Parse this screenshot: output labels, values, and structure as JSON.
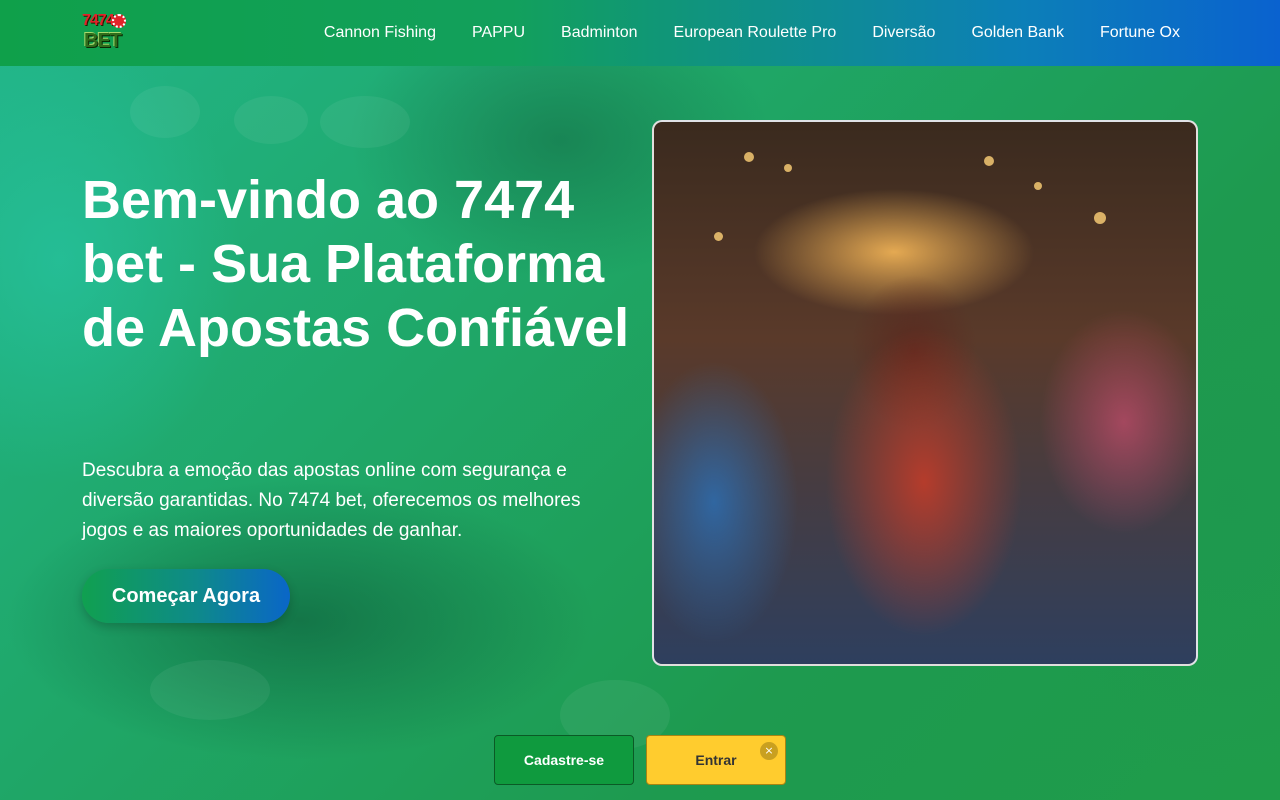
{
  "header": {
    "logo_text_top": "7474",
    "logo_text_bottom": "BET",
    "nav": [
      {
        "label": "Cannon Fishing"
      },
      {
        "label": "PAPPU"
      },
      {
        "label": "Badminton"
      },
      {
        "label": "European Roulette Pro"
      },
      {
        "label": "Diversão"
      },
      {
        "label": "Golden Bank"
      },
      {
        "label": "Fortune Ox"
      }
    ]
  },
  "hero": {
    "title": "Bem-vindo ao 7474 bet - Sua Plataforma de Apostas Confiável",
    "description": "Descubra a emoção das apostas online com segurança e diversão garantidas. No 7474 bet, oferecemos os melhores jogos e as maiores oportunidades de ganhar.",
    "cta_label": "Começar Agora"
  },
  "bottom_bar": {
    "register_label": "Cadastre-se",
    "login_label": "Entrar",
    "close_label": "×"
  },
  "colors": {
    "header_start": "#0fa04a",
    "header_end": "#0a62cf",
    "register": "#0f9a3e",
    "login": "#ffcc2e"
  }
}
